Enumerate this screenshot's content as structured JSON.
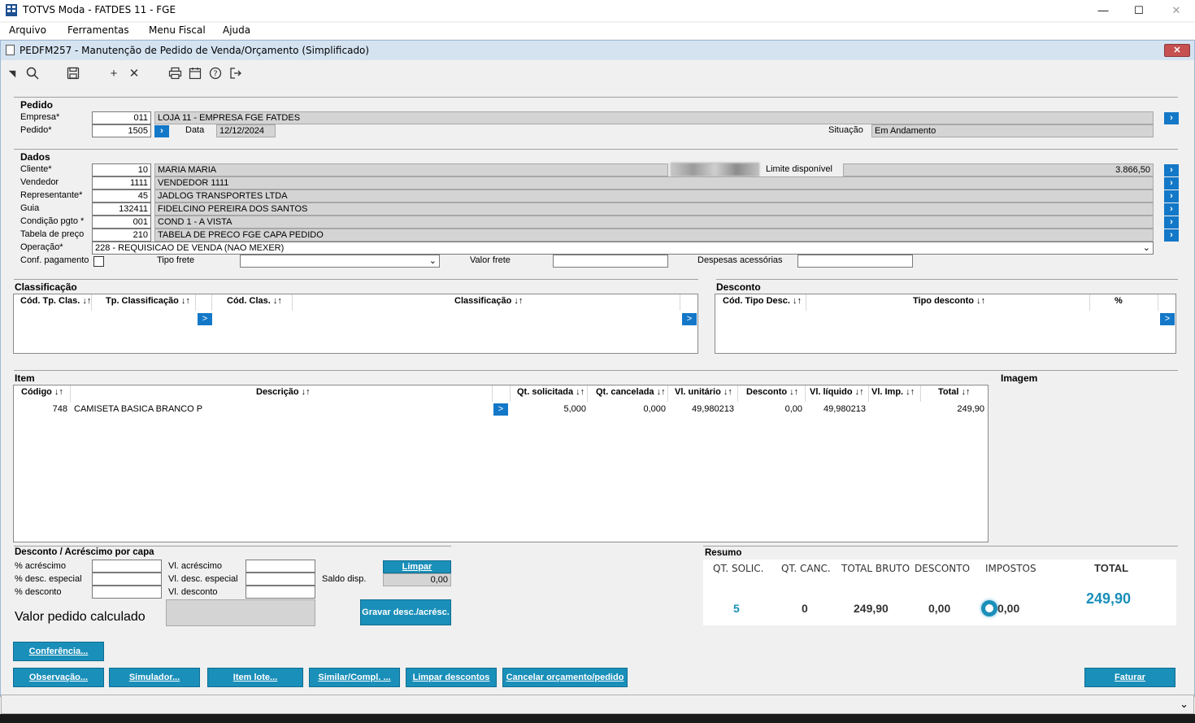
{
  "window": {
    "title": "TOTVS Moda - FATDES 11 - FGE",
    "minimize": "—",
    "maximize": "☐",
    "close": "✕"
  },
  "menu": {
    "items": [
      {
        "label": "Arquivo"
      },
      {
        "label": "Ferramentas"
      },
      {
        "label": "Menu Fiscal"
      },
      {
        "label": "Ajuda"
      }
    ]
  },
  "form": {
    "title": "PEDFM257 - Manutenção de Pedido de Venda/Orçamento (Simplificado)",
    "close": "✕"
  },
  "pedido": {
    "section": "Pedido",
    "empresa_label": "Empresa*",
    "empresa_code": "011",
    "empresa_name": "LOJA 11 - EMPRESA FGE FATDES",
    "pedido_label": "Pedido*",
    "pedido_value": "1505",
    "data_label": "Data",
    "data_value": "12/12/2024",
    "situacao_label": "Situação",
    "situacao_value": "Em Andamento"
  },
  "dados": {
    "section": "Dados",
    "cliente_label": "Cliente*",
    "cliente_code": "10",
    "cliente_name": "MARIA MARIA",
    "limite_label": "Limite disponível",
    "limite_value": "3.866,50",
    "vendedor_label": "Vendedor",
    "vendedor_code": "1111",
    "vendedor_name": "VENDEDOR 1111",
    "representante_label": "Representante*",
    "representante_code": "45",
    "representante_name": "JADLOG TRANSPORTES LTDA",
    "guia_label": "Guia",
    "guia_code": "132411",
    "guia_name": "FIDELCINO PEREIRA DOS SANTOS",
    "condicao_label": "Condição pgto *",
    "condicao_code": "001",
    "condicao_name": "COND 1 - A VISTA",
    "tabela_label": "Tabela de preço",
    "tabela_code": "210",
    "tabela_name": "TABELA DE PRECO FGE CAPA PEDIDO",
    "operacao_label": "Operação*",
    "operacao_value": "228 - REQUISICAO DE VENDA (NAO MEXER)",
    "conf_label": "Conf. pagamento",
    "tipo_frete_label": "Tipo frete",
    "valor_frete_label": "Valor frete",
    "despesas_label": "Despesas acessórias"
  },
  "classificacao": {
    "section": "Classificação",
    "columns": [
      "Cód. Tp. Clas. ↓↑",
      "Tp. Classificação ↓↑",
      "Cód. Clas. ↓↑",
      "Classificação ↓↑"
    ],
    "btn": ">"
  },
  "desconto": {
    "section": "Desconto",
    "columns": [
      "Cód. Tipo Desc. ↓↑",
      "Tipo desconto ↓↑",
      "%"
    ],
    "btn": ">"
  },
  "item": {
    "section": "Item",
    "imagem_label": "Imagem",
    "columns": [
      "Código ↓↑",
      "Descrição ↓↑",
      "Qt. solicitada ↓↑",
      "Qt. cancelada ↓↑",
      "Vl. unitário ↓↑",
      "Desconto ↓↑",
      "Vl. líquido ↓↑",
      "Vl. Imp. ↓↑",
      "Total ↓↑"
    ],
    "rows": [
      {
        "codigo": "748",
        "descricao": "CAMISETA BASICA BRANCO P",
        "qt_solicitada": "5,000",
        "qt_cancelada": "0,000",
        "vl_unitario": "49,980213",
        "desconto": "0,00",
        "vl_liquido": "49,980213",
        "vl_imp": "",
        "total": "249,90"
      }
    ],
    "btn": ">"
  },
  "desc_capa": {
    "section": "Desconto / Acréscimo por capa",
    "pct_acrescimo": "% acréscimo",
    "pct_desc_especial": "% desc. especial",
    "pct_desconto": "% desconto",
    "vl_acrescimo": "Vl. acréscimo",
    "vl_desc_especial": "Vl. desc. especial",
    "vl_desconto": "Vl. desconto",
    "limpar": "Limpar",
    "saldo_label": "Saldo disp.",
    "saldo_value": "0,00",
    "gravar": "Gravar desc./acrésc.",
    "valor_calc_label": "Valor pedido calculado"
  },
  "resumo": {
    "section": "Resumo",
    "headers": {
      "qt_solic": "QT. SOLIC.",
      "qt_canc": "QT. CANC.",
      "total_bruto": "TOTAL BRUTO",
      "desconto": "DESCONTO",
      "impostos": "IMPOSTOS",
      "total": "TOTAL"
    },
    "values": {
      "qt_solic": "5",
      "qt_canc": "0",
      "total_bruto": "249,90",
      "desconto": "0,00",
      "impostos": "0,00",
      "total": "249,90"
    }
  },
  "buttons": {
    "conferencia": "Conferência...",
    "observacao": "Observação...",
    "simulador": "Simulador...",
    "item_lote": "Item lote...",
    "similar": "Similar/Compl. ...",
    "limpar_descontos": "Limpar descontos",
    "cancelar": "Cancelar orçamento/pedido",
    "faturar": "Faturar"
  },
  "colors": {
    "accent": "#1a8fb9",
    "chevron": "#1478c8",
    "total_value": "#1a8fb9"
  }
}
